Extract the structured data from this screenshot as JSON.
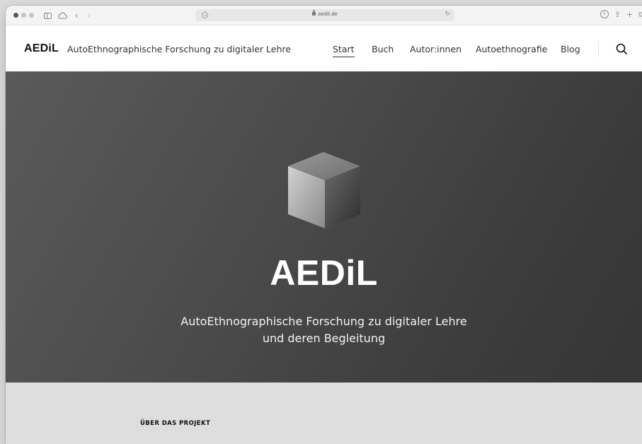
{
  "browser": {
    "url": "aedil.de",
    "icons": [
      "sidebar-icon",
      "cloud-icon",
      "back-icon",
      "forward-icon",
      "shield-icon",
      "lock-icon",
      "reload-icon",
      "download-icon",
      "share-icon",
      "new-tab-icon",
      "tabs-icon"
    ],
    "back_glyph": "‹",
    "forward_glyph": "›",
    "reload_glyph": "↻",
    "share_glyph": "⇪",
    "new_tab_glyph": "+",
    "tabs_glyph": "⧉",
    "download_glyph": "↓"
  },
  "header": {
    "logo": "AEDiL",
    "tagline": "AutoEthnographische Forschung zu digitaler Lehre",
    "nav": [
      {
        "label": "Start",
        "active": true
      },
      {
        "label": "Buch",
        "active": false
      },
      {
        "label": "Autor:innen",
        "active": false
      },
      {
        "label": "Autoethnografie",
        "active": false
      },
      {
        "label": "Blog",
        "active": false
      }
    ]
  },
  "hero": {
    "title": "AEDiL",
    "subtitle_line1": "AutoEthnographische Forschung zu digitaler Lehre",
    "subtitle_line2": "und deren Begleitung"
  },
  "about": {
    "label": "ÜBER DAS PROJEKT"
  },
  "colors": {
    "hero_bg": "#4b4b4b",
    "about_bg": "#dedede",
    "text_dark": "#111111"
  }
}
